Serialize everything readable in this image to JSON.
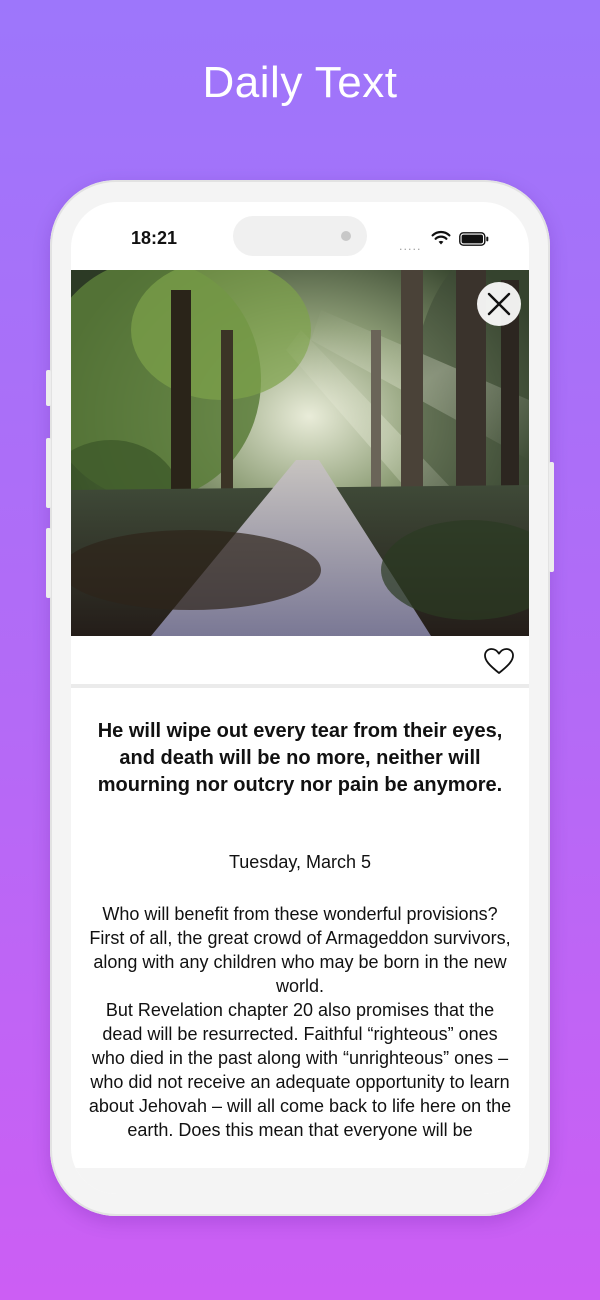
{
  "header": {
    "title": "Daily Text"
  },
  "status_bar": {
    "time": "18:21",
    "signal": "....."
  },
  "photo": {
    "description_icon": "forest-path-image"
  },
  "actions": {
    "close_icon": "close-icon",
    "favorite_icon": "heart-outline-icon"
  },
  "daily_text": {
    "verse": "He will wipe out every tear from their eyes, and death will be no more, neither will mourning nor outcry nor pain be anymore.",
    "date": "Tuesday, March 5",
    "body": "Who will benefit from these wonderful provisions? First of all, the great crowd of Armageddon survivors, along with any children who may be born in the new world.\nBut Revelation chapter 20 also promises that the dead will be resurrected. Faithful “righteous” ones who died in the past along with “unrighteous” ones – who did not receive an adequate opportunity to learn about Jehovah – will all come back to life here on the earth. Does this mean that everyone will be"
  },
  "colors": {
    "background_top": "#9d76fb",
    "background_bottom": "#cc5ef4",
    "phone_frame": "#f4f4f4"
  }
}
